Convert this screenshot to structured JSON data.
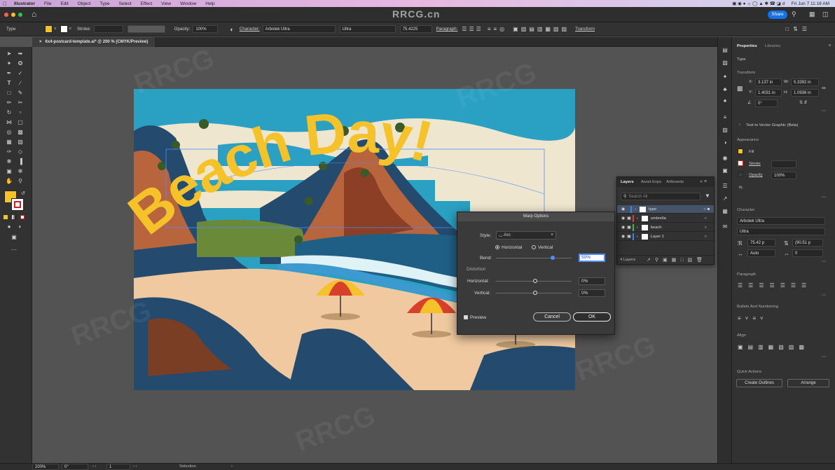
{
  "menubar": {
    "app_name": "Illustrator",
    "items": [
      "File",
      "Edit",
      "Object",
      "Type",
      "Select",
      "Effect",
      "View",
      "Window",
      "Help"
    ],
    "clock": "Fri Jun 7  11:18 AM"
  },
  "titlebar": {
    "watermark": "RRCG.cn",
    "share_label": "Share"
  },
  "control_bar": {
    "type_label": "Type",
    "stroke_label": "Stroke:",
    "opacity_label": "Opacity:",
    "opacity_value": "100%",
    "character_label": "Character:",
    "font_family": "Arbotek Ultra",
    "font_style": "Ultra",
    "font_size": "75.4225",
    "paragraph_label": "Paragraph:",
    "transform_label": "Transform"
  },
  "document": {
    "tab_title": "6x4-postcard-template.ai* @ 200 % (CMYK/Preview)",
    "headline": "Beach Day!"
  },
  "colors": {
    "fill_yellow": "#f5c22a",
    "sky_blue": "#2aa0c2",
    "sand": "#f0c9a0",
    "rock_brown": "#b8643c",
    "umbrella_red": "#d8402c",
    "accent_blue": "#3b82f6"
  },
  "properties_panel": {
    "tabs": [
      "Properties",
      "Libraries"
    ],
    "selection_type": "Type",
    "transform_label": "Transform",
    "x_value": "3.137 in",
    "y_value": "1.4031 in",
    "w_value": "5.3392 in",
    "h_value": "1.0936 in",
    "rotation": "0°",
    "text_to_vector": "Text to Vector Graphic (Beta)",
    "appearance_label": "Appearance",
    "fill_label": "Fill",
    "stroke_label": "Stroke",
    "opacity_label": "Opacity",
    "opacity_value": "100%",
    "fx_label": "fx.",
    "character_label": "Character",
    "font_family": "Arbotek Ultra",
    "font_style": "Ultra",
    "font_size": "75.42 p",
    "leading": "(90.51 p",
    "kerning": "Auto",
    "tracking": "0",
    "paragraph_label": "Paragraph",
    "bullets_label": "Bullets And Numbering",
    "align_label": "Align",
    "quick_actions_label": "Quick Actions",
    "create_outlines": "Create Outlines",
    "arrange": "Arrange"
  },
  "layers_panel": {
    "tabs": [
      "Layers",
      "Asset Expo",
      "Artboards"
    ],
    "search_placeholder": "Search All",
    "layers": [
      {
        "name": "type",
        "color": "#3b82f6"
      },
      {
        "name": "umbrella",
        "color": "#e23b3b"
      },
      {
        "name": "beach",
        "color": "#39c24a"
      },
      {
        "name": "Layer 1",
        "color": "#3b82f6"
      }
    ],
    "count": "4 Layers"
  },
  "warp_dialog": {
    "title": "Warp Options",
    "style_label": "Style:",
    "style_value": "Arc",
    "horizontal_label": "Horizontal",
    "vertical_label": "Vertical",
    "bend_label": "Bend:",
    "bend_value": "50%",
    "bend_fraction": 0.5,
    "distortion_label": "Distortion",
    "dist_h_label": "Horizontal:",
    "dist_h_value": "0%",
    "dist_v_label": "Vertical:",
    "dist_v_value": "0%",
    "preview_label": "Preview",
    "cancel_label": "Cancel",
    "ok_label": "OK"
  },
  "statusbar": {
    "zoom": "200%",
    "rotation": "0°",
    "artboard": "1",
    "mode": "Selection"
  }
}
